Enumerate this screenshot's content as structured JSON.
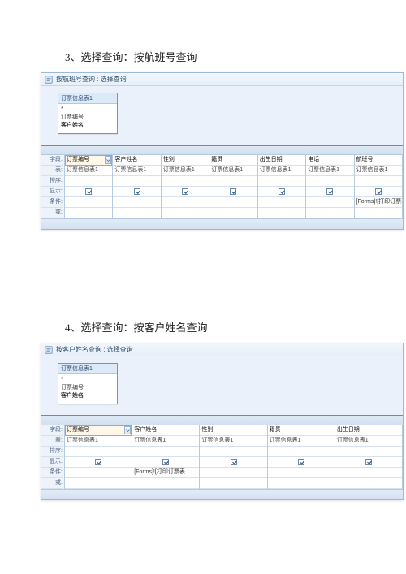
{
  "section1": {
    "heading": "3、选择查询：按航班号查询",
    "window_title": "按航班号查询 : 选择查询",
    "source": {
      "title": "订票信息表1",
      "star": "*",
      "lines": [
        "订票编号",
        "客户姓名"
      ],
      "bold_idx": 1
    },
    "row_labels": [
      "字段:",
      "表:",
      "排序:",
      "显示:",
      "条件:",
      "或:"
    ],
    "columns": [
      {
        "field": "订票编号",
        "table": "订票信息表1",
        "show": true,
        "cond": "",
        "selected": true
      },
      {
        "field": "客户姓名",
        "table": "订票信息表1",
        "show": true,
        "cond": ""
      },
      {
        "field": "性别",
        "table": "订票信息表1",
        "show": true,
        "cond": ""
      },
      {
        "field": "籍贯",
        "table": "订票信息表1",
        "show": true,
        "cond": ""
      },
      {
        "field": "出生日期",
        "table": "订票信息表1",
        "show": true,
        "cond": ""
      },
      {
        "field": "电话",
        "table": "订票信息表1",
        "show": true,
        "cond": ""
      },
      {
        "field": "航班号",
        "table": "订票信息表1",
        "show": true,
        "cond": "[Forms]![打印订票表"
      }
    ]
  },
  "section2": {
    "heading": "4、选择查询：按客户姓名查询",
    "window_title": "按客户姓名查询 : 选择查询",
    "source": {
      "title": "订票信息表1",
      "star": "*",
      "lines": [
        "订票编号",
        "客户姓名"
      ],
      "bold_idx": 1
    },
    "row_labels": [
      "字段:",
      "表:",
      "排序:",
      "显示:",
      "条件:",
      "或:"
    ],
    "columns": [
      {
        "field": "订票编号",
        "table": "订票信息表1",
        "show": true,
        "cond": "",
        "selected": true
      },
      {
        "field": "客户姓名",
        "table": "订票信息表1",
        "show": true,
        "cond": "[Forms]![打印订票表"
      },
      {
        "field": "性别",
        "table": "订票信息表1",
        "show": true,
        "cond": ""
      },
      {
        "field": "籍贯",
        "table": "订票信息表1",
        "show": true,
        "cond": ""
      },
      {
        "field": "出生日期",
        "table": "订票信息表1",
        "show": true,
        "cond": ""
      }
    ]
  }
}
